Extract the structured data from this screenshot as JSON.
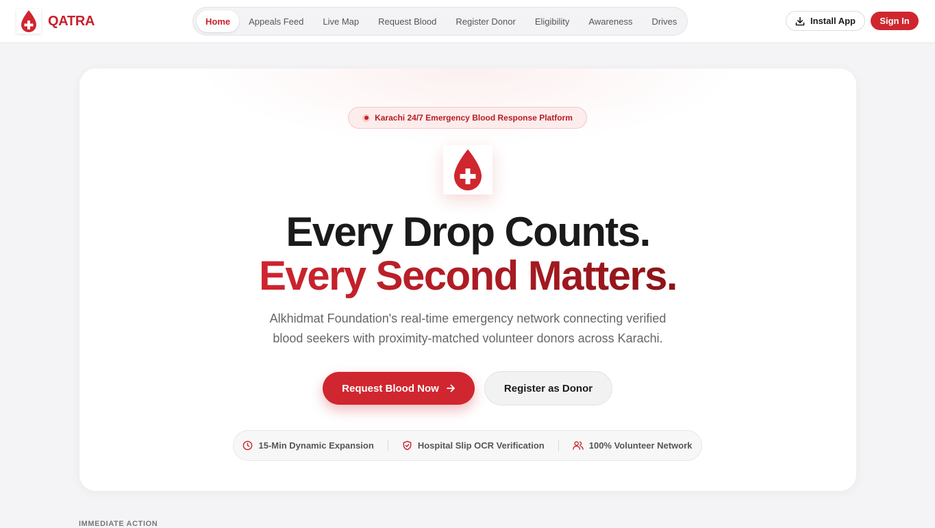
{
  "brand": {
    "name": "QATRA",
    "logo_icon": "blood-drop-cross-icon",
    "accent": "#c8202a"
  },
  "nav": {
    "items": [
      {
        "label": "Home",
        "active": true
      },
      {
        "label": "Appeals Feed",
        "active": false
      },
      {
        "label": "Live Map",
        "active": false
      },
      {
        "label": "Request Blood",
        "active": false
      },
      {
        "label": "Register Donor",
        "active": false
      },
      {
        "label": "Eligibility",
        "active": false
      },
      {
        "label": "Awareness",
        "active": false
      },
      {
        "label": "Drives",
        "active": false
      }
    ]
  },
  "header": {
    "install_label": "Install App",
    "install_icon": "download-icon",
    "signin_label": "Sign In"
  },
  "hero": {
    "badge": "Karachi 24/7 Emergency Blood Response Platform",
    "headline_line1": "Every Drop Counts.",
    "headline_line2": "Every Second Matters.",
    "subtitle": "Alkhidmat Foundation's real-time emergency network connecting verified blood seekers with proximity-matched volunteer donors across Karachi.",
    "cta_primary": "Request Blood Now",
    "cta_primary_icon": "arrow-right-icon",
    "cta_secondary": "Register as Donor",
    "features": [
      {
        "icon": "clock-icon",
        "label": "15-Min Dynamic Expansion"
      },
      {
        "icon": "shield-check-icon",
        "label": "Hospital Slip OCR Verification"
      },
      {
        "icon": "users-icon",
        "label": "100% Volunteer Network"
      }
    ]
  },
  "next_section": {
    "label": "IMMEDIATE ACTION"
  },
  "colors": {
    "primary": "#d0262f",
    "headline_dark": "#1a1a1a",
    "gradient_end": "#8c1418",
    "page_bg": "#f4f4f6"
  }
}
